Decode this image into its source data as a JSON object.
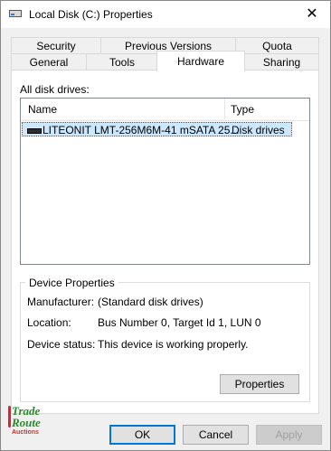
{
  "window": {
    "title": "Local Disk (C:) Properties",
    "close_glyph": "✕"
  },
  "tabs": {
    "row1": [
      {
        "label": "Security"
      },
      {
        "label": "Previous Versions"
      },
      {
        "label": "Quota"
      }
    ],
    "row2": [
      {
        "label": "General"
      },
      {
        "label": "Tools"
      },
      {
        "label": "Hardware",
        "active": true
      },
      {
        "label": "Sharing"
      }
    ]
  },
  "hardware": {
    "all_disk_drives_label": "All disk drives:",
    "columns": {
      "name": "Name",
      "type": "Type"
    },
    "rows": [
      {
        "name": "LITEONIT LMT-256M6M-41 mSATA 25...",
        "type": "Disk drives",
        "selected": true
      }
    ],
    "device_properties": {
      "legend": "Device Properties",
      "manufacturer_label": "Manufacturer:",
      "manufacturer_value": "(Standard disk drives)",
      "location_label": "Location:",
      "location_value": "Bus Number 0, Target Id 1, LUN 0",
      "status_label": "Device status:",
      "status_value": "This device is working properly.",
      "properties_button": "Properties"
    }
  },
  "footer": {
    "ok": "OK",
    "cancel": "Cancel",
    "apply": "Apply"
  },
  "watermark": {
    "line1": "Trade",
    "line2": "Route",
    "line3": "Auctions"
  },
  "colors": {
    "selection": "#cce8ff",
    "accent": "#0078d7"
  }
}
